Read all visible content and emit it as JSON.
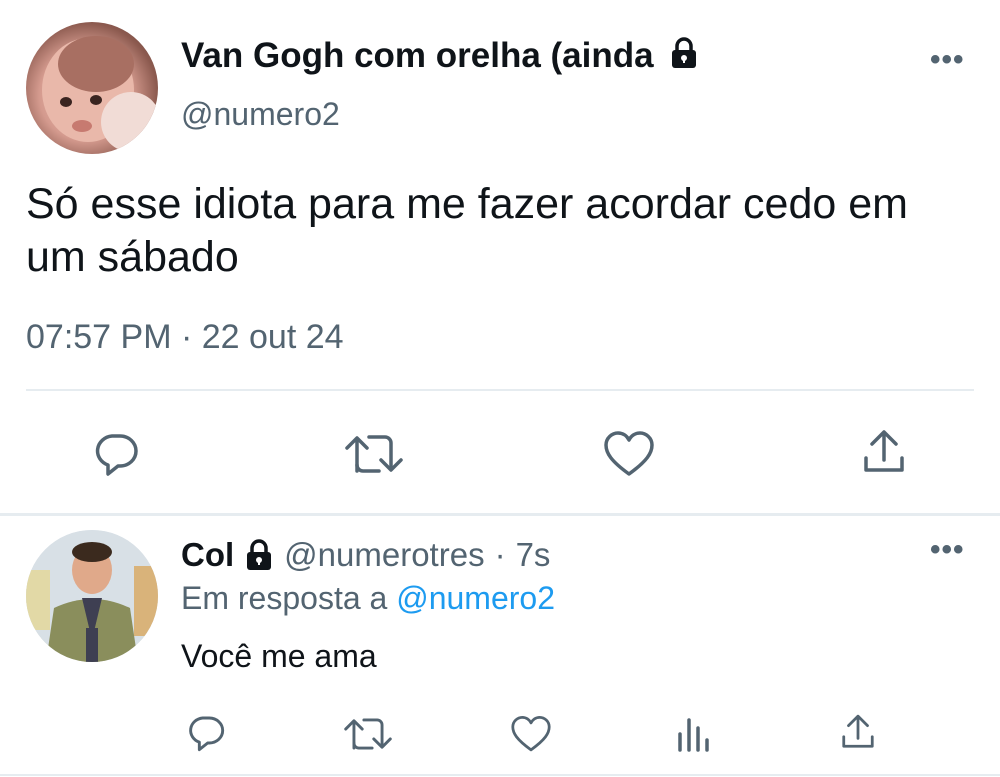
{
  "tweet": {
    "display_name": "Van Gogh com orelha (ainda",
    "handle": "@numero2",
    "text": "Só esse idiota para me fazer acordar cedo em um sábado",
    "timestamp": "07:57 PM · 22 out 24",
    "more_icon": "•••",
    "actions": [
      "reply-icon",
      "retweet-icon",
      "like-icon",
      "share-icon"
    ]
  },
  "reply": {
    "display_name": "Col",
    "handle": "@numerotres",
    "separator": "·",
    "time": "7s",
    "reply_prefix": "Em resposta a",
    "reply_to": "@numero2",
    "text": "Você me ama",
    "more_icon": "•••",
    "actions": [
      "reply-icon",
      "retweet-icon",
      "like-icon",
      "analytics-icon",
      "share-icon"
    ]
  },
  "colors": {
    "primary_text": "#0f1419",
    "secondary_text": "#536471",
    "link": "#1d9bf0",
    "divider": "#e6ecf0"
  }
}
